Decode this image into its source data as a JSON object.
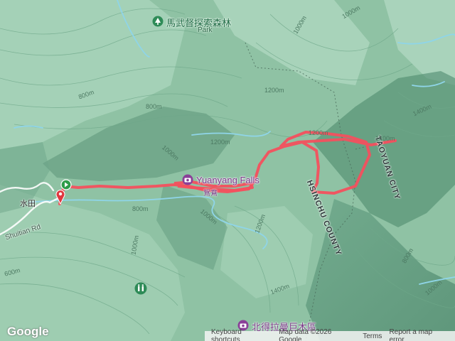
{
  "map": {
    "colors": {
      "base": "#8fc2a4",
      "route": "#f4505e",
      "water": "#8fd5e8",
      "start_marker": "#2e9c4a",
      "end_marker": "#e0383f"
    },
    "labels": {
      "forest_park": "馬武督探索森林",
      "forest_park_sub": "Park",
      "falls": "Yuanyang Falls",
      "falls_zh_fragment": "鴛鴦",
      "giant_trees": "北得拉曼巨木區",
      "county_hsinchu": "HSINCHU COUNTY",
      "county_taoyuan": "TAOYUAN CITY",
      "road": "Shuitian Rd",
      "village": "水田"
    },
    "elevations": {
      "e1": "1000m",
      "e2": "800m",
      "e3": "1000m",
      "e4": "800m",
      "e5": "1200m",
      "e6": "1200m",
      "e7": "1400m",
      "e8": "1200m",
      "e9": "1000m",
      "e10": "1000m",
      "e11": "1200m",
      "e12": "1400m",
      "e13": "600m",
      "e14": "1400m",
      "e15": "1000m",
      "e16": "800m",
      "e17": "800m",
      "e18": "1000m"
    },
    "icons": {
      "park": "tree-pin-icon",
      "falls": "camera-pin-icon",
      "giant_trees": "camera-pin-icon",
      "restroom": "restroom-pin-icon",
      "start": "start-marker-icon",
      "end": "end-marker-icon"
    }
  },
  "footer": {
    "logo": "Google",
    "keyboard_shortcuts": "Keyboard shortcuts",
    "map_data": "Map data ©2026 Google",
    "terms": "Terms",
    "report": "Report a map error"
  }
}
